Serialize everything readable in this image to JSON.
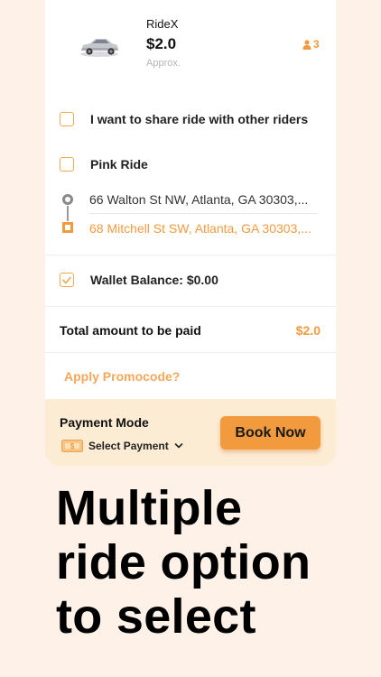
{
  "ride": {
    "name": "RideX",
    "price": "$2.0",
    "approx_label": "Approx.",
    "capacity": "3",
    "car_icon": "car-icon",
    "person_icon": "person-icon"
  },
  "options": [
    {
      "label": "I want to share ride with other riders",
      "checked": false
    },
    {
      "label": "Pink Ride",
      "checked": false
    }
  ],
  "route": {
    "pickup": "66 Walton St NW, Atlanta, GA 30303,...",
    "dropoff": "68 Mitchell St SW, Atlanta, GA 30303,..."
  },
  "wallet": {
    "label": "Wallet Balance: $0.00",
    "checked": true
  },
  "total": {
    "label": "Total amount to be paid",
    "value": "$2.0"
  },
  "promo": {
    "label": "Apply Promocode?"
  },
  "payment": {
    "title": "Payment Mode",
    "select_label": "Select Payment",
    "book_label": "Book Now"
  },
  "headline": {
    "lines": [
      "Multiple",
      "ride option",
      "to select"
    ]
  },
  "colors": {
    "accent": "#f19a3e",
    "background": "#fdf1e8",
    "payment_bar": "#fdecd4"
  }
}
